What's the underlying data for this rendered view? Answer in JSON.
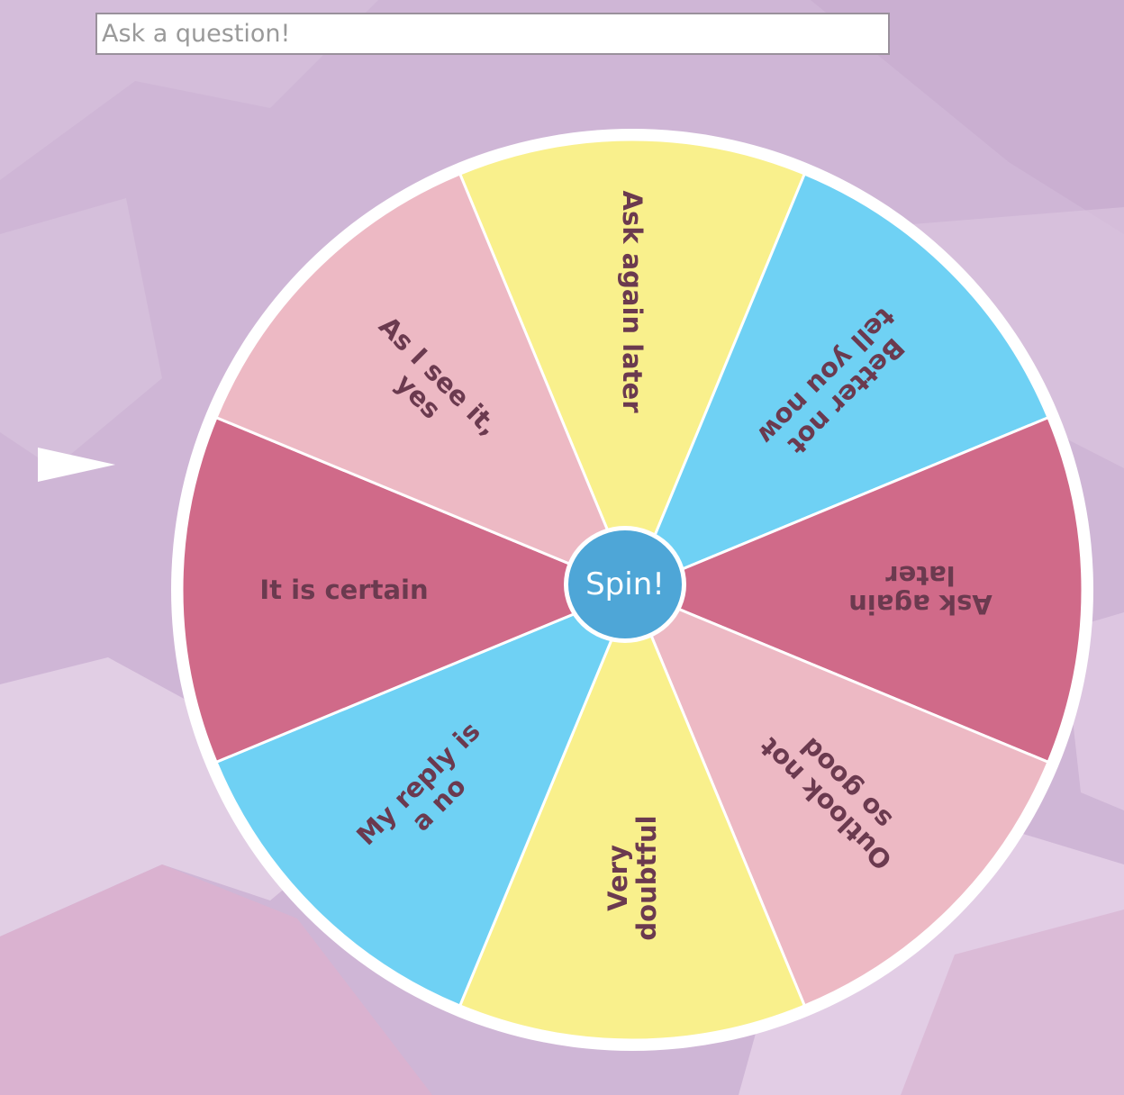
{
  "question_input": {
    "placeholder": "Ask a question!",
    "value": ""
  },
  "spin_button": {
    "label": "Spin!"
  },
  "pointer": {
    "icon": "triangle-pointer-icon",
    "color": "#ffffff"
  },
  "wheel": {
    "rim_color": "#ffffff",
    "label_color": "#6b3a4f",
    "segments": [
      {
        "label_lines": [
          "Ask again later"
        ],
        "color": "#f9f08c"
      },
      {
        "label_lines": [
          "Better not",
          "tell you now"
        ],
        "color": "#6fd1f4"
      },
      {
        "label_lines": [
          "Ask again",
          "later"
        ],
        "color": "#d06a89"
      },
      {
        "label_lines": [
          "Outlook not",
          "so good"
        ],
        "color": "#edb9c4"
      },
      {
        "label_lines": [
          "Very",
          "doubtful"
        ],
        "color": "#f9f08c"
      },
      {
        "label_lines": [
          "My reply is",
          "a no"
        ],
        "color": "#6fd1f4"
      },
      {
        "label_lines": [
          "It is certain"
        ],
        "color": "#d06a89"
      },
      {
        "label_lines": [
          "As I see it,",
          "yes"
        ],
        "color": "#edb9c4"
      }
    ]
  },
  "background": {
    "base_color": "#cfb6d6",
    "light_color": "#e6d3e8",
    "pink_color": "#dcb2cf"
  }
}
